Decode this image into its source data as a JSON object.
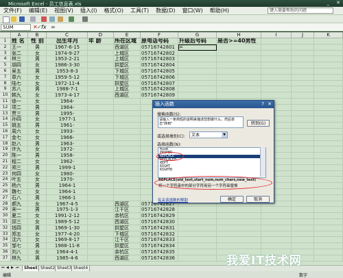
{
  "window": {
    "title": "Microsoft Excel - 员工信息表.xls"
  },
  "menu": {
    "items": [
      "文件(F)",
      "编辑(E)",
      "视图(V)",
      "插入(I)",
      "格式(O)",
      "工具(T)",
      "数据(D)",
      "窗口(W)",
      "帮助(H)"
    ],
    "help_placeholder": "键入需要帮助的问题"
  },
  "formula": {
    "name_box": "SUM",
    "fx": "fx",
    "x": "✕",
    "check": "✓",
    "content": "="
  },
  "columns": [
    "A",
    "B",
    "C",
    "D",
    "E",
    "F",
    "G",
    "H",
    "I",
    "J",
    "K"
  ],
  "headers": [
    "姓 名",
    "性 别",
    "出生年月",
    "年 龄",
    "所在区域",
    "原电话号码",
    "升级后号码",
    "是否>=40男性"
  ],
  "rows": [
    {
      "n": "1"
    },
    {
      "n": "2",
      "name": "王一",
      "sex": "男",
      "birth": "1967-6-15",
      "area": "西湖区",
      "phone": "05716742801",
      "g": "="
    },
    {
      "n": "3",
      "name": "张二",
      "sex": "女",
      "birth": "1974-9-27",
      "area": "上城区",
      "phone": "05716742802"
    },
    {
      "n": "4",
      "name": "林三",
      "sex": "男",
      "birth": "1953-2-21",
      "area": "上城区",
      "phone": "05716742803"
    },
    {
      "n": "5",
      "name": "胡四",
      "sex": "女",
      "birth": "1986-3-30",
      "area": "拱墅区",
      "phone": "05716742804"
    },
    {
      "n": "6",
      "name": "吴五",
      "sex": "男",
      "birth": "1953-8-3",
      "area": "下城区",
      "phone": "05716742805"
    },
    {
      "n": "7",
      "name": "章六",
      "sex": "女",
      "birth": "1959-5-12",
      "area": "下城区",
      "phone": "05716742806"
    },
    {
      "n": "8",
      "name": "陆七",
      "sex": "女",
      "birth": "1972-11-4",
      "area": "拱墅区",
      "phone": "05716742807"
    },
    {
      "n": "9",
      "name": "苏八",
      "sex": "男",
      "birth": "1988-7-1",
      "area": "上城区",
      "phone": "05716742808"
    },
    {
      "n": "10",
      "name": "韩九",
      "sex": "女",
      "birth": "1973-4-17",
      "area": "西湖区",
      "phone": "05716742809"
    },
    {
      "n": "11",
      "name": "徐一",
      "sex": "女",
      "birth": "1964-"
    },
    {
      "n": "12",
      "name": "项二",
      "sex": "男",
      "birth": "1964-"
    },
    {
      "n": "13",
      "name": "贾三",
      "sex": "男",
      "birth": "1995-"
    },
    {
      "n": "14",
      "name": "孙四",
      "sex": "女",
      "birth": "1977-1"
    },
    {
      "n": "15",
      "name": "姚五",
      "sex": "男",
      "birth": "1961-"
    },
    {
      "n": "16",
      "name": "周六",
      "sex": "女",
      "birth": "1993-"
    },
    {
      "n": "17",
      "name": "金七",
      "sex": "女",
      "birth": "1966-"
    },
    {
      "n": "18",
      "name": "赵八",
      "sex": "男",
      "birth": "1963-"
    },
    {
      "n": "19",
      "name": "许九",
      "sex": "女",
      "birth": "1972-"
    },
    {
      "n": "20",
      "name": "陈一",
      "sex": "男",
      "birth": "1958-"
    },
    {
      "n": "21",
      "name": "程二",
      "sex": "女",
      "birth": "1962-"
    },
    {
      "n": "22",
      "name": "郑三",
      "sex": "男",
      "birth": "1999-1"
    },
    {
      "n": "23",
      "name": "何四",
      "sex": "女",
      "birth": "1980-"
    },
    {
      "n": "24",
      "name": "叶五",
      "sex": "女",
      "birth": "1970-"
    },
    {
      "n": "25",
      "name": "杨六",
      "sex": "男",
      "birth": "1964-1"
    },
    {
      "n": "26",
      "name": "魏七",
      "sex": "女",
      "birth": "1964-1"
    },
    {
      "n": "27",
      "name": "石八",
      "sex": "男",
      "birth": "1966-1"
    },
    {
      "n": "28",
      "name": "郝九",
      "sex": "女",
      "birth": "1967-4-5",
      "area": "西湖区",
      "phone": "05716742827"
    },
    {
      "n": "29",
      "name": "宋一",
      "sex": "男",
      "birth": "1975-1-3",
      "area": "江干区",
      "phone": "05716742828"
    },
    {
      "n": "30",
      "name": "夏二",
      "sex": "女",
      "birth": "1991-2-12",
      "area": "余杭区",
      "phone": "05716742829"
    },
    {
      "n": "31",
      "name": "邱三",
      "sex": "女",
      "birth": "1989-5-12",
      "area": "西湖区",
      "phone": "05716742830"
    },
    {
      "n": "32",
      "name": "钱四",
      "sex": "男",
      "birth": "1969-1-30",
      "area": "拱墅区",
      "phone": "05716742831"
    },
    {
      "n": "33",
      "name": "郑五",
      "sex": "女",
      "birth": "1977-4-20",
      "area": "下城区",
      "phone": "05716742832"
    },
    {
      "n": "34",
      "name": "沈六",
      "sex": "女",
      "birth": "1969-8-17",
      "area": "江干区",
      "phone": "05716742833"
    },
    {
      "n": "35",
      "name": "邹七",
      "sex": "男",
      "birth": "1988-11-8",
      "area": "拱墅区",
      "phone": "05716742834"
    },
    {
      "n": "36",
      "name": "刘八",
      "sex": "女",
      "birth": "1964-4-1",
      "area": "余杭区",
      "phone": "05716742835"
    },
    {
      "n": "37",
      "name": "林九",
      "sex": "男",
      "birth": "1985-4-6",
      "area": "西湖区",
      "phone": "05716742836"
    }
  ],
  "dialog": {
    "title": "插入函数",
    "help_mark": "?",
    "close_mark": "✕",
    "search_label": "搜索函数(S):",
    "search_value": "请输入一条简短的说明来描述您想做什么，然后单击\"转到\"",
    "go_button": "转到(G)",
    "category_label": "或选择类别(C):",
    "category_value": "文本",
    "function_label": "选择函数(N):",
    "functions": [
      "MIDB",
      "PROPER",
      "REPLACE",
      "REPLACEB",
      "REPT",
      "RIGHT",
      "RIGHTB"
    ],
    "selected_index": 2,
    "signature": "REPLACE(old_text,start_num,num_chars,new_text)",
    "description": "将一个字符串中的部分字符用另一个字符串替换",
    "help_link": "有关该函数的帮助",
    "ok_button": "确定",
    "cancel_button": "取消",
    "colors": {
      "ring": "#e0262a",
      "title": "#2a5590",
      "selection": "#1c3f7a"
    }
  },
  "sheets": [
    "Sheet1",
    "Sheet2",
    "Sheet3",
    "Sheet4"
  ],
  "status": {
    "left": "编辑",
    "right": "数字"
  },
  "watermark": "我爱IT技术网"
}
